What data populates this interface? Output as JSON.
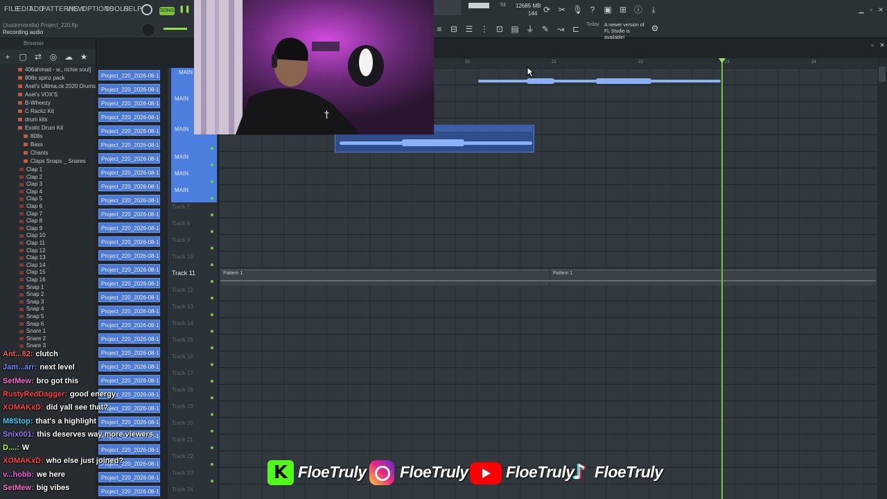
{
  "menu": [
    "FILE",
    "EDIT",
    "ADD",
    "PATTERNS",
    "VIEW",
    "OPTIONS",
    "TOOLS",
    "HELP"
  ],
  "song_mode": "SONG",
  "hint": {
    "line1": "(Justinmorella) Project_220.flp",
    "line2": "Recording audio"
  },
  "stats": {
    "cpu": "53",
    "memory": "12685 MB",
    "poly": "144"
  },
  "news": {
    "date": "Today",
    "text": "A newer version of FL Studio is available!"
  },
  "browser": {
    "title": "Browser",
    "items": [
      "406ahmad - w., richie soul]",
      "808s spinz pack",
      "Axel's Ultima.ck 2020 Drums",
      "Axel's VOX'S",
      "B-Wheezy",
      "C Rackz Kit",
      "drum kits",
      "Exotic Drum Kit",
      "808s",
      "Bass",
      "Chants",
      "Claps Snaps _ Snares",
      "Clap 1",
      "Clap 2",
      "Clap 3",
      "Clap 4",
      "Clap 5",
      "Clap 6",
      "Clap 7",
      "Clap 8",
      "Clap 9",
      "Clap 10",
      "Clap 11",
      "Clap 12",
      "Clap 13",
      "Clap 14",
      "Clap 15",
      "Clap 16",
      "Snap 1",
      "Snap 2",
      "Snap 3",
      "Snap 4",
      "Snap 5",
      "Snap 6",
      "Snare 1",
      "Snare 2",
      "Snare 3"
    ]
  },
  "picker_clip": "Project_220_2026-08-13...",
  "main_label": "MAIN",
  "tracks": [
    "Track 7",
    "Track 8",
    "Track 9",
    "Track 10",
    "Track 11",
    "Track 12",
    "Track 13",
    "Track 14",
    "Track 15",
    "Track 16",
    "Track 17",
    "Track 18",
    "Track 19",
    "Track 20",
    "Track 21",
    "Track 22",
    "Track 23",
    "Track 24"
  ],
  "ruler": [
    "20",
    "21",
    "22",
    "23",
    "24"
  ],
  "pattern_label": "Pattern 1",
  "chat": [
    {
      "user": "Ant...82:",
      "msg": "clutch",
      "color": "#ff5a5a"
    },
    {
      "user": "Jam...arr:",
      "msg": "next level",
      "color": "#6e8cff"
    },
    {
      "user": "SetMew:",
      "msg": "bro got this",
      "color": "#ff6ad5"
    },
    {
      "user": "RustyRedDagger:",
      "msg": "good energy",
      "color": "#ff4444"
    },
    {
      "user": "XOMAKxD:",
      "msg": "did yall see that?",
      "color": "#ff4444"
    },
    {
      "user": "M8Stop:",
      "msg": "that's a highlight",
      "color": "#3ad6ff"
    },
    {
      "user": "Snix001:",
      "msg": "this deserves way more viewers",
      "color": "#9b7dff"
    },
    {
      "user": "D....:",
      "msg": "W",
      "color": "#b8ff5a"
    },
    {
      "user": "XOMAKxD:",
      "msg": "who else just joined?",
      "color": "#ff4444"
    },
    {
      "user": "v...hobb:",
      "msg": "we here",
      "color": "#ff5ae6"
    },
    {
      "user": "SetMew:",
      "msg": "big vibes",
      "color": "#ff6ad5"
    }
  ],
  "socials": [
    {
      "platform": "kick-icon",
      "handle": "FloeTruly",
      "color": "#53fc18"
    },
    {
      "platform": "instagram-icon",
      "handle": "FloeTruly",
      "color": "#e1306c"
    },
    {
      "platform": "youtube-icon",
      "handle": "FloeTruly",
      "color": "#ff0000"
    },
    {
      "platform": "tiktok-icon",
      "handle": "FloeTruly",
      "color": "#ffffff"
    }
  ]
}
